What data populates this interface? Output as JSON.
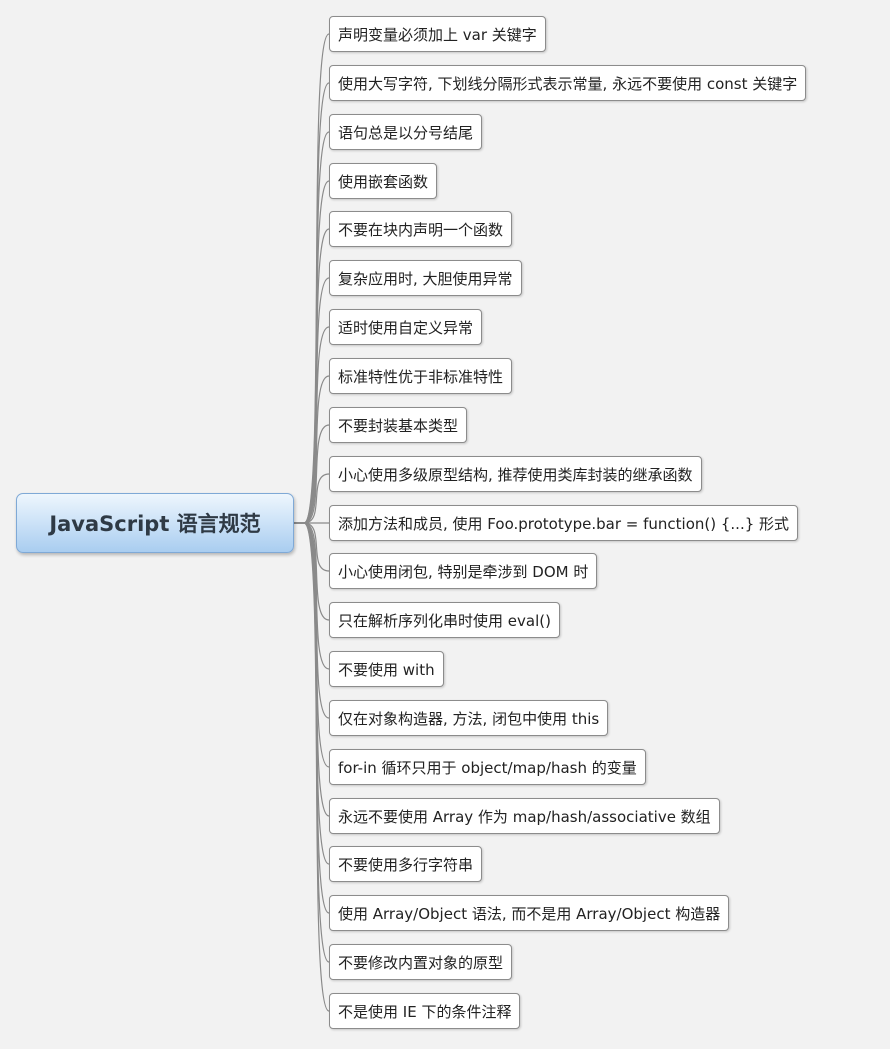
{
  "root": {
    "label": "JavaScript 语言规范"
  },
  "branches": [
    {
      "label": "声明变量必须加上 var 关键字"
    },
    {
      "label": "使用大写字符, 下划线分隔形式表示常量, 永远不要使用 const 关键字"
    },
    {
      "label": "语句总是以分号结尾"
    },
    {
      "label": "使用嵌套函数"
    },
    {
      "label": "不要在块内声明一个函数"
    },
    {
      "label": "复杂应用时, 大胆使用异常"
    },
    {
      "label": "适时使用自定义异常"
    },
    {
      "label": "标准特性优于非标准特性"
    },
    {
      "label": "不要封装基本类型"
    },
    {
      "label": "小心使用多级原型结构, 推荐使用类库封装的继承函数"
    },
    {
      "label": "添加方法和成员, 使用 Foo.prototype.bar = function() {...} 形式"
    },
    {
      "label": "小心使用闭包, 特别是牵涉到 DOM 时"
    },
    {
      "label": "只在解析序列化串时使用 eval()"
    },
    {
      "label": "不要使用 with"
    },
    {
      "label": "仅在对象构造器, 方法, 闭包中使用 this"
    },
    {
      "label": "for-in 循环只用于 object/map/hash 的变量"
    },
    {
      "label": "永远不要使用 Array 作为 map/hash/associative 数组"
    },
    {
      "label": "不要使用多行字符串"
    },
    {
      "label": "使用 Array/Object 语法, 而不是用 Array/Object 构造器"
    },
    {
      "label": "不要修改内置对象的原型"
    },
    {
      "label": "不是使用 IE 下的条件注释"
    }
  ]
}
